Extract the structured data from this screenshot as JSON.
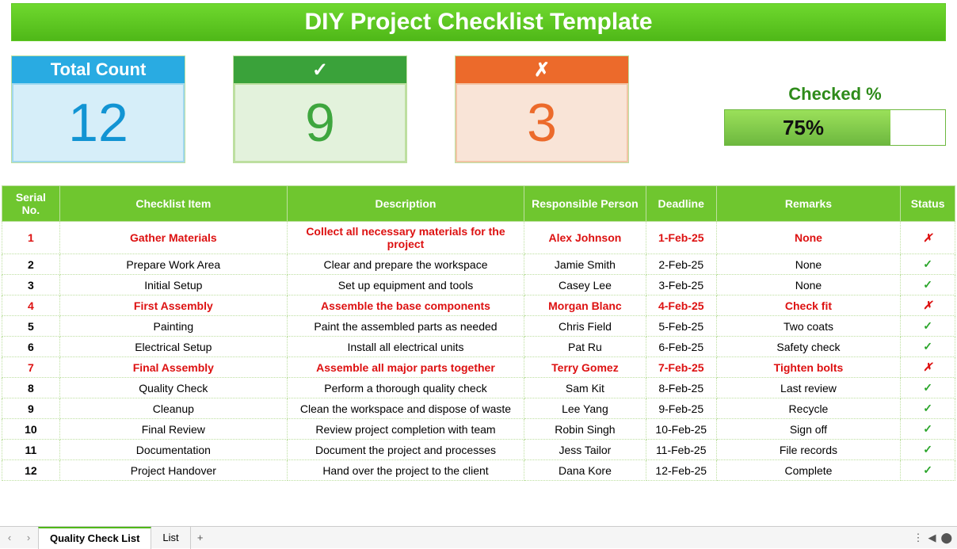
{
  "title": "DIY Project Checklist Template",
  "cards": {
    "total": {
      "label": "Total Count",
      "value": "12"
    },
    "yes": {
      "label": "✓",
      "value": "9"
    },
    "no": {
      "label": "✗",
      "value": "3"
    }
  },
  "checked": {
    "label": "Checked %",
    "percent": 75,
    "display": "75%"
  },
  "columns": {
    "serial": "Serial No.",
    "item": "Checklist Item",
    "desc": "Description",
    "resp": "Responsible Person",
    "dead": "Deadline",
    "rem": "Remarks",
    "status": "Status"
  },
  "rows": [
    {
      "n": "1",
      "item": "Gather Materials",
      "desc": "Collect all necessary materials for the project",
      "resp": "Alex Johnson",
      "dead": "1-Feb-25",
      "rem": "None",
      "ok": false
    },
    {
      "n": "2",
      "item": "Prepare Work Area",
      "desc": "Clear and prepare the workspace",
      "resp": "Jamie Smith",
      "dead": "2-Feb-25",
      "rem": "None",
      "ok": true
    },
    {
      "n": "3",
      "item": "Initial Setup",
      "desc": "Set up equipment and tools",
      "resp": "Casey Lee",
      "dead": "3-Feb-25",
      "rem": "None",
      "ok": true
    },
    {
      "n": "4",
      "item": "First Assembly",
      "desc": "Assemble the base components",
      "resp": "Morgan Blanc",
      "dead": "4-Feb-25",
      "rem": "Check fit",
      "ok": false
    },
    {
      "n": "5",
      "item": "Painting",
      "desc": "Paint the assembled parts as needed",
      "resp": "Chris Field",
      "dead": "5-Feb-25",
      "rem": "Two coats",
      "ok": true
    },
    {
      "n": "6",
      "item": "Electrical Setup",
      "desc": "Install all electrical units",
      "resp": "Pat Ru",
      "dead": "6-Feb-25",
      "rem": "Safety check",
      "ok": true
    },
    {
      "n": "7",
      "item": "Final Assembly",
      "desc": "Assemble all major parts together",
      "resp": "Terry Gomez",
      "dead": "7-Feb-25",
      "rem": "Tighten bolts",
      "ok": false
    },
    {
      "n": "8",
      "item": "Quality Check",
      "desc": "Perform a thorough quality check",
      "resp": "Sam Kit",
      "dead": "8-Feb-25",
      "rem": "Last review",
      "ok": true
    },
    {
      "n": "9",
      "item": "Cleanup",
      "desc": "Clean the workspace and dispose of waste",
      "resp": "Lee Yang",
      "dead": "9-Feb-25",
      "rem": "Recycle",
      "ok": true
    },
    {
      "n": "10",
      "item": "Final Review",
      "desc": "Review project completion with team",
      "resp": "Robin Singh",
      "dead": "10-Feb-25",
      "rem": "Sign off",
      "ok": true
    },
    {
      "n": "11",
      "item": "Documentation",
      "desc": "Document the project and processes",
      "resp": "Jess Tailor",
      "dead": "11-Feb-25",
      "rem": "File records",
      "ok": true
    },
    {
      "n": "12",
      "item": "Project Handover",
      "desc": "Hand over the project to the client",
      "resp": "Dana Kore",
      "dead": "12-Feb-25",
      "rem": "Complete",
      "ok": true
    }
  ],
  "tabs": {
    "active": "Quality Check List",
    "others": [
      "List"
    ]
  }
}
